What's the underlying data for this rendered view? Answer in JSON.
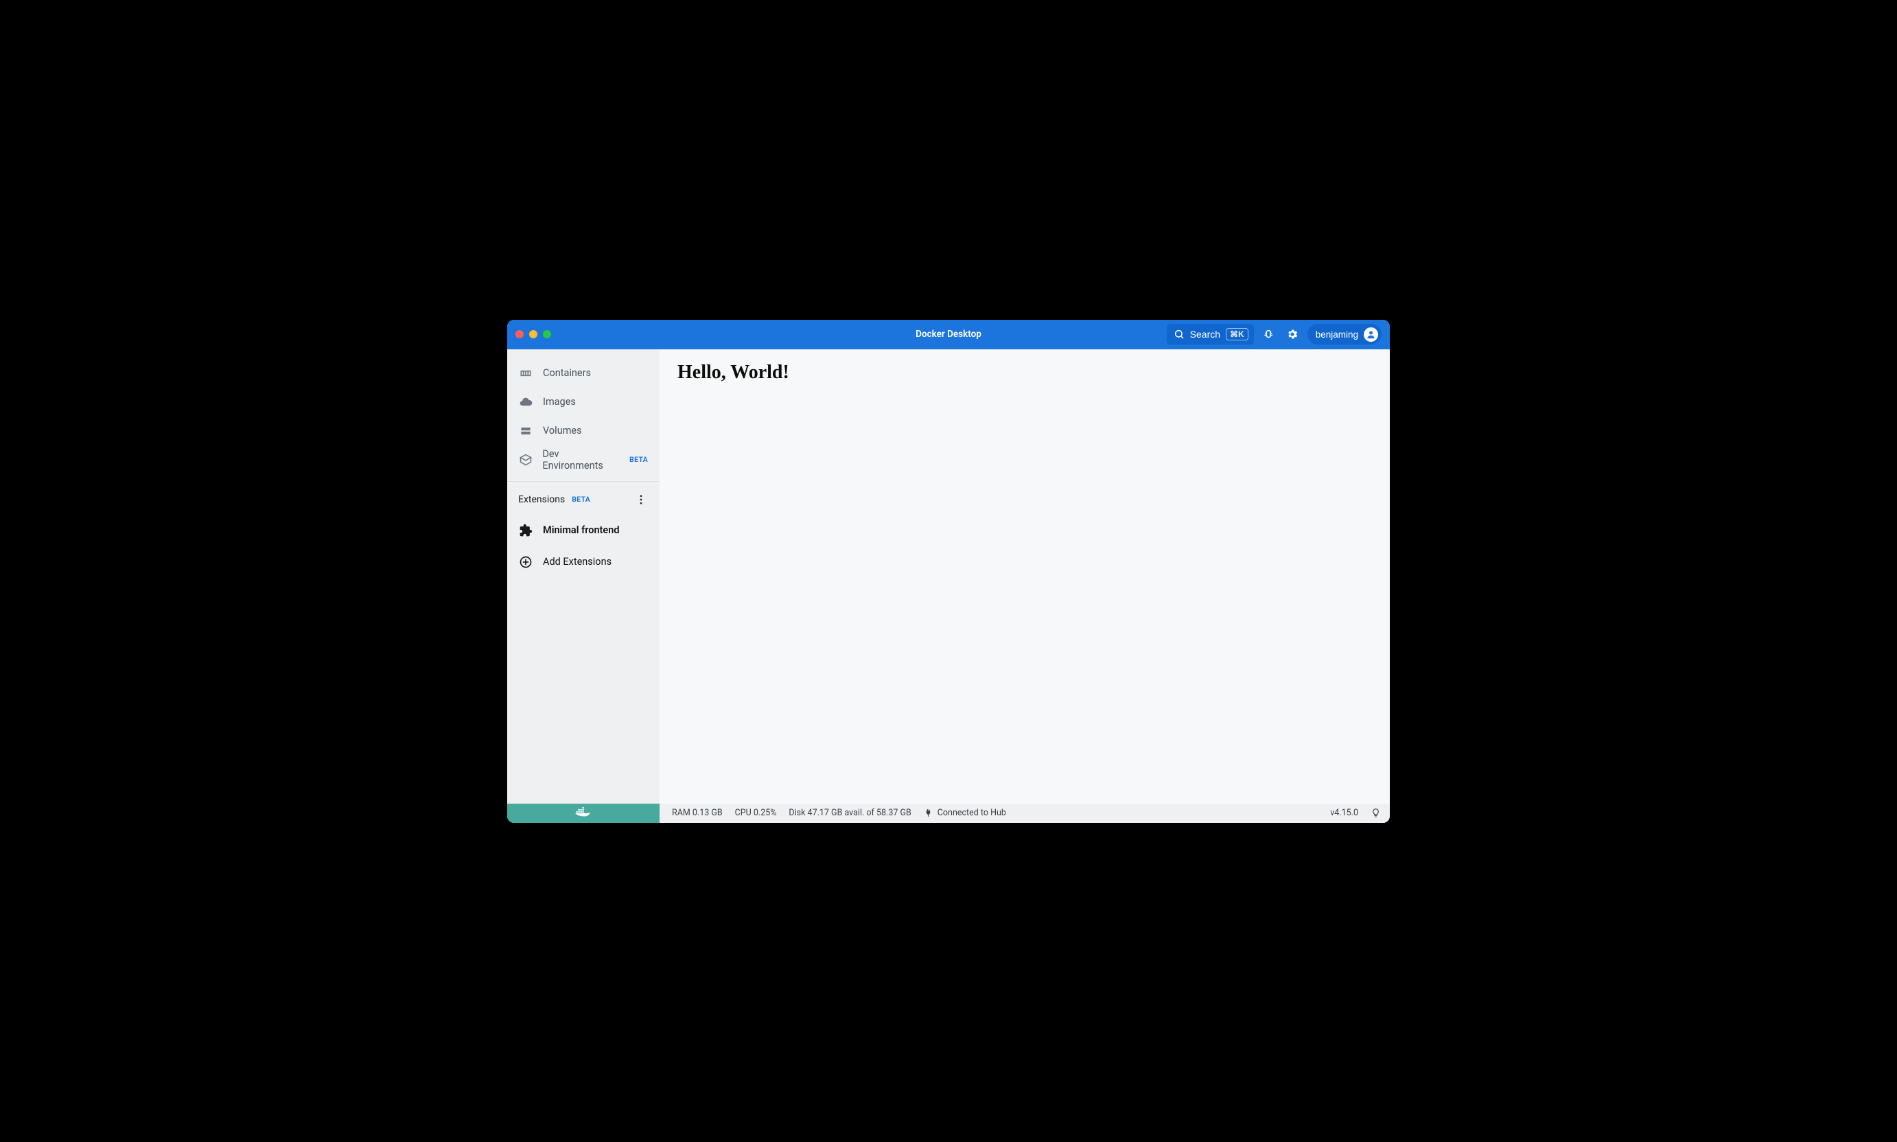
{
  "titlebar": {
    "title": "Docker Desktop",
    "search_label": "Search",
    "search_shortcut": "⌘K"
  },
  "user": {
    "name": "benjaming"
  },
  "sidebar": {
    "items": [
      {
        "label": "Containers"
      },
      {
        "label": "Images"
      },
      {
        "label": "Volumes"
      },
      {
        "label": "Dev Environments",
        "badge": "BETA"
      }
    ],
    "extensions_header": "Extensions",
    "extensions_badge": "BETA",
    "extensions": [
      {
        "label": "Minimal frontend"
      }
    ],
    "add_extensions_label": "Add Extensions"
  },
  "main": {
    "heading": "Hello, World!"
  },
  "footer": {
    "ram": "RAM 0.13 GB",
    "cpu": "CPU 0.25%",
    "disk": "Disk 47.17 GB avail. of 58.37 GB",
    "connection": "Connected to Hub",
    "version": "v4.15.0"
  }
}
